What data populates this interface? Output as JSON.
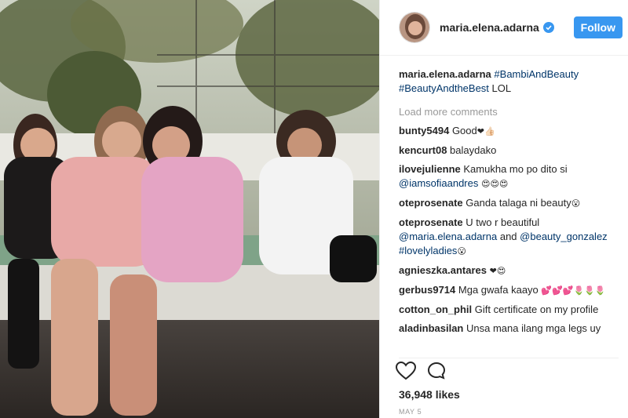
{
  "post": {
    "username": "maria.elena.adarna",
    "follow_label": "Follow",
    "caption_user": "maria.elena.adarna",
    "caption_tags": [
      "#BambiAndBeauty",
      "#BeautyAndtheBest"
    ],
    "caption_tail": "LOL",
    "load_more": "Load more comments",
    "likes": "36,948 likes",
    "date": "MAY 5"
  },
  "comments": [
    {
      "user": "bunty5494",
      "text": "Good",
      "emoji": "❤👍🏻"
    },
    {
      "user": "kencurt08",
      "text": "balaydako",
      "emoji": ""
    },
    {
      "user": "ilovejulienne",
      "text": "Kamukha mo po dito si",
      "mention": "@iamsofiaandres",
      "emoji": "😍😍😍"
    },
    {
      "user": "oteprosenate",
      "text": "Ganda talaga ni beauty",
      "emoji": "😮"
    },
    {
      "user": "oteprosenate",
      "text": "U two r beautiful",
      "mention": "@maria.elena.adarna",
      "text2": "and",
      "mention2": "@beauty_gonzalez",
      "tag": "#lovelyladies",
      "emoji": "😮"
    },
    {
      "user": "agnieszka.antares",
      "text": "",
      "emoji": "❤😍"
    },
    {
      "user": "gerbus9714",
      "text": "Mga gwafa kaayo",
      "emoji": "💕💕💕🌷🌷🌷"
    },
    {
      "user": "cotton_on_phil",
      "text": "Gift certificate on my profile",
      "emoji": ""
    },
    {
      "user": "aladinbasilan",
      "text": "Unsa mana ilang mga legs uy",
      "emoji": ""
    }
  ],
  "icons": {
    "verified": "verified-badge-icon",
    "like": "heart-icon",
    "comment": "speech-bubble-icon"
  },
  "colors": {
    "accent": "#3897f0",
    "tag": "#003569",
    "muted": "#999999"
  }
}
